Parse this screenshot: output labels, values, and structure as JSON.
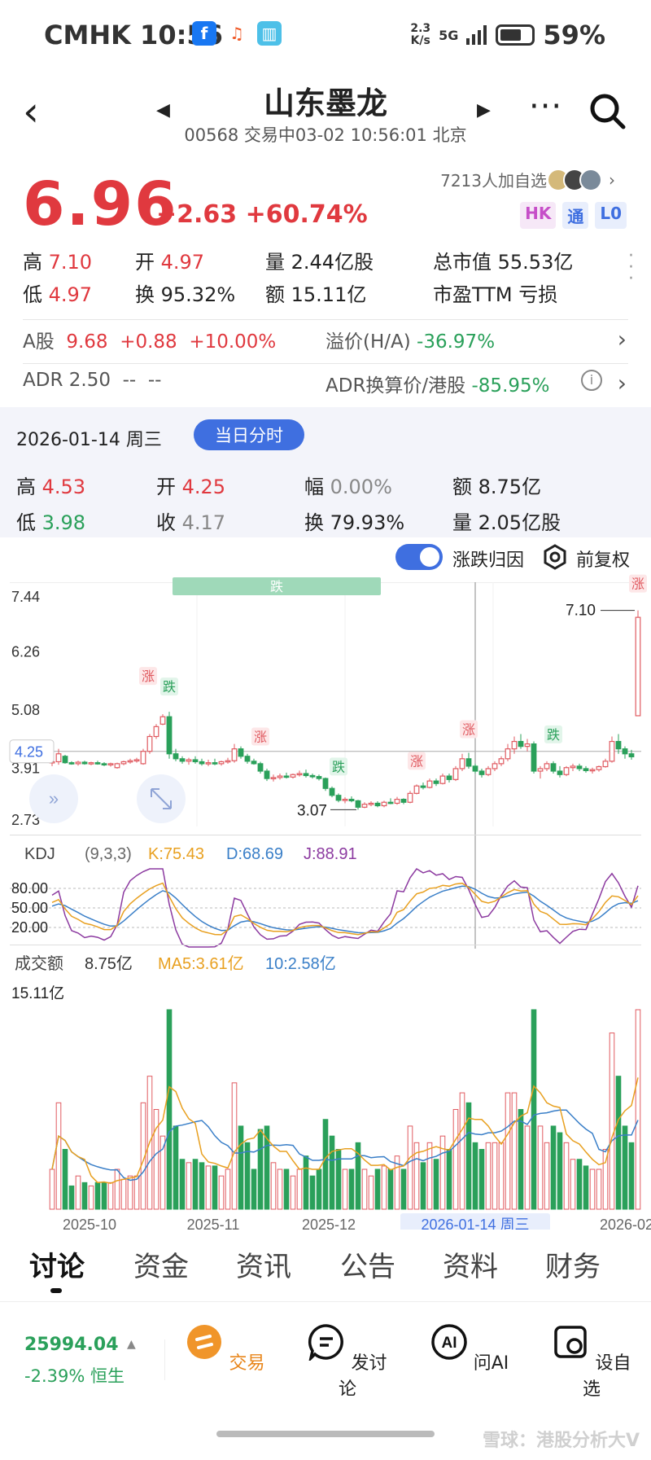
{
  "status_bar": {
    "carrier": "CMHK",
    "time": "10:56",
    "speed_top": "2.3",
    "speed_bottom": "K/s",
    "network": "5G",
    "battery": "59%",
    "battery_level": 0.59
  },
  "header": {
    "title": "山东墨龙",
    "subtitle": "00568 交易中03-02 10:56:01 北京",
    "more_icon": "more-dots-icon",
    "search_icon": "search-icon"
  },
  "quote": {
    "price": "6.96",
    "change": "+2.63",
    "change_pct": "+60.74%",
    "watchers": "7213人加自选",
    "badges": [
      "HK",
      "通",
      "L0"
    ],
    "high_label": "高",
    "high": "7.10",
    "open_label": "开",
    "open": "4.97",
    "volume_label": "量",
    "volume": "2.44亿股",
    "mcap_label": "总市值",
    "mcap": "55.53亿",
    "low_label": "低",
    "low": "4.97",
    "turnover_label": "换",
    "turnover": "95.32%",
    "amount_label": "额",
    "amount": "15.11亿",
    "pe_label": "市盈TTM",
    "pe": "亏损",
    "a_share": {
      "label": "A股",
      "price": "9.68",
      "change": "+0.88",
      "pct": "+10.00%",
      "premium_label": "溢价(H/A)",
      "premium": "-36.97%"
    },
    "adr": {
      "label": "ADR",
      "price": "2.50",
      "v1": "--",
      "v2": "--",
      "conv_label": "ADR换算价/港股",
      "conv": "-85.95%"
    }
  },
  "day_panel": {
    "date": "2026-01-14 周三",
    "button": "当日分时",
    "high_label": "高",
    "high": "4.53",
    "open_label": "开",
    "open": "4.25",
    "amp_label": "幅",
    "amp": "0.00%",
    "amount_label": "额",
    "amount": "8.75亿",
    "low_label": "低",
    "low": "3.98",
    "close_label": "收",
    "close": "4.17",
    "turn_label": "换",
    "turn": "79.93%",
    "vol_label": "量",
    "vol": "2.05亿股"
  },
  "toolbar": {
    "toggle_label": "涨跌归因",
    "adjust_label": "前复权"
  },
  "chart_data": [
    {
      "type": "candlestick",
      "title": "",
      "ylim": [
        2.73,
        7.44
      ],
      "y_ticks": [
        "7.44",
        "6.26",
        "5.08",
        "3.91",
        "2.73"
      ],
      "crosshair_value": "4.25",
      "max_label": "7.10",
      "min_label": "3.07",
      "event_labels": [
        "跌",
        "跌",
        "涨",
        "涨",
        "跌",
        "涨",
        "涨",
        "跌",
        "涨"
      ],
      "candles": [
        [
          4.02,
          4.07,
          3.95,
          4.04
        ],
        [
          4.04,
          4.3,
          3.98,
          4.2
        ],
        [
          4.15,
          4.18,
          4.0,
          4.02
        ],
        [
          4.02,
          4.05,
          3.98,
          4.0
        ],
        [
          4.0,
          4.06,
          3.96,
          4.03
        ],
        [
          4.03,
          4.06,
          3.98,
          4.0
        ],
        [
          4.0,
          4.04,
          3.97,
          4.02
        ],
        [
          4.02,
          4.06,
          3.98,
          4.0
        ],
        [
          4.0,
          4.03,
          3.95,
          3.98
        ],
        [
          3.98,
          4.02,
          3.94,
          4.0
        ],
        [
          3.92,
          4.02,
          3.9,
          4.0
        ],
        [
          4.0,
          4.06,
          3.97,
          4.04
        ],
        [
          4.04,
          4.1,
          4.0,
          4.06
        ],
        [
          4.06,
          4.12,
          4.02,
          4.08
        ],
        [
          4.0,
          4.3,
          3.98,
          4.25
        ],
        [
          4.25,
          4.6,
          4.2,
          4.55
        ],
        [
          4.55,
          4.8,
          4.5,
          4.75
        ],
        [
          4.8,
          5.0,
          4.78,
          4.95
        ],
        [
          4.95,
          5.05,
          4.1,
          4.2
        ],
        [
          4.2,
          4.3,
          4.05,
          4.1
        ],
        [
          4.1,
          4.15,
          4.0,
          4.05
        ],
        [
          4.05,
          4.12,
          3.98,
          4.08
        ],
        [
          4.08,
          4.15,
          4.0,
          4.04
        ],
        [
          4.04,
          4.1,
          3.96,
          4.0
        ],
        [
          4.0,
          4.08,
          3.95,
          4.02
        ],
        [
          4.02,
          4.1,
          3.97,
          4.0
        ],
        [
          4.0,
          4.06,
          3.96,
          4.04
        ],
        [
          4.04,
          4.12,
          4.0,
          4.06
        ],
        [
          4.06,
          4.4,
          4.02,
          4.3
        ],
        [
          4.3,
          4.35,
          4.1,
          4.15
        ],
        [
          4.15,
          4.2,
          4.0,
          4.05
        ],
        [
          4.05,
          4.1,
          3.98,
          4.0
        ],
        [
          4.0,
          4.04,
          3.8,
          3.85
        ],
        [
          3.85,
          3.9,
          3.65,
          3.7
        ],
        [
          3.7,
          3.78,
          3.64,
          3.72
        ],
        [
          3.72,
          3.8,
          3.68,
          3.75
        ],
        [
          3.75,
          3.82,
          3.7,
          3.73
        ],
        [
          3.73,
          3.8,
          3.7,
          3.78
        ],
        [
          3.78,
          3.86,
          3.74,
          3.8
        ],
        [
          3.8,
          3.88,
          3.72,
          3.76
        ],
        [
          3.76,
          3.8,
          3.7,
          3.74
        ],
        [
          3.74,
          3.78,
          3.66,
          3.7
        ],
        [
          3.7,
          3.72,
          3.45,
          3.5
        ],
        [
          3.5,
          3.54,
          3.32,
          3.36
        ],
        [
          3.36,
          3.4,
          3.22,
          3.26
        ],
        [
          3.26,
          3.32,
          3.2,
          3.28
        ],
        [
          3.28,
          3.34,
          3.22,
          3.25
        ],
        [
          3.25,
          3.27,
          3.07,
          3.12
        ],
        [
          3.12,
          3.22,
          3.1,
          3.18
        ],
        [
          3.18,
          3.24,
          3.14,
          3.2
        ],
        [
          3.2,
          3.24,
          3.12,
          3.15
        ],
        [
          3.15,
          3.25,
          3.12,
          3.22
        ],
        [
          3.22,
          3.3,
          3.18,
          3.2
        ],
        [
          3.2,
          3.33,
          3.17,
          3.28
        ],
        [
          3.28,
          3.3,
          3.18,
          3.22
        ],
        [
          3.22,
          3.45,
          3.2,
          3.4
        ],
        [
          3.4,
          3.58,
          3.38,
          3.55
        ],
        [
          3.55,
          3.62,
          3.48,
          3.52
        ],
        [
          3.52,
          3.7,
          3.5,
          3.65
        ],
        [
          3.65,
          3.7,
          3.55,
          3.6
        ],
        [
          3.6,
          3.8,
          3.58,
          3.75
        ],
        [
          3.75,
          3.8,
          3.62,
          3.68
        ],
        [
          3.68,
          3.95,
          3.65,
          3.9
        ],
        [
          3.9,
          4.2,
          3.85,
          4.1
        ],
        [
          4.1,
          4.22,
          3.9,
          3.95
        ],
        [
          3.95,
          4.0,
          3.8,
          3.85
        ],
        [
          3.85,
          3.9,
          3.72,
          3.78
        ],
        [
          3.78,
          3.95,
          3.75,
          3.9
        ],
        [
          3.9,
          4.05,
          3.85,
          4.0
        ],
        [
          4.0,
          4.15,
          3.95,
          4.1
        ],
        [
          4.1,
          4.4,
          4.05,
          4.3
        ],
        [
          4.3,
          4.55,
          4.2,
          4.45
        ],
        [
          4.45,
          4.6,
          4.3,
          4.35
        ],
        [
          4.35,
          4.5,
          4.25,
          4.4
        ],
        [
          4.4,
          4.45,
          3.8,
          3.85
        ],
        [
          3.85,
          3.95,
          3.7,
          3.9
        ],
        [
          3.9,
          4.05,
          3.85,
          4.0
        ],
        [
          4.0,
          4.05,
          3.8,
          3.85
        ],
        [
          3.85,
          3.95,
          3.72,
          3.78
        ],
        [
          3.78,
          3.95,
          3.75,
          3.92
        ],
        [
          3.92,
          4.0,
          3.85,
          3.95
        ],
        [
          3.95,
          4.0,
          3.85,
          3.9
        ],
        [
          3.9,
          3.95,
          3.82,
          3.86
        ],
        [
          3.86,
          3.92,
          3.8,
          3.88
        ],
        [
          3.88,
          3.96,
          3.84,
          3.94
        ],
        [
          3.94,
          4.1,
          3.92,
          4.05
        ],
        [
          4.05,
          4.55,
          4.02,
          4.45
        ],
        [
          4.45,
          4.6,
          4.2,
          4.3
        ],
        [
          4.3,
          4.35,
          4.1,
          4.2
        ],
        [
          4.2,
          4.28,
          4.08,
          4.14
        ],
        [
          4.97,
          7.1,
          4.97,
          6.96
        ]
      ]
    },
    {
      "type": "line",
      "title": "KDJ",
      "params": "(9,3,3)",
      "series_labels": [
        {
          "name": "K",
          "value": "75.43"
        },
        {
          "name": "D",
          "value": "68.69"
        },
        {
          "name": "J",
          "value": "88.91"
        }
      ],
      "colors": {
        "K": "#e8a020",
        "D": "#3a7fc8",
        "J": "#8c3aa0"
      },
      "y_ticks": [
        "80.00",
        "50.00",
        "20.00"
      ],
      "ylim": [
        0,
        100
      ]
    },
    {
      "type": "bar",
      "title": "成交额",
      "latest": "8.75亿",
      "ma_labels": [
        {
          "name": "MA5",
          "value": "3.61亿"
        },
        {
          "name": "10",
          "value": "2.58亿"
        }
      ],
      "y_max_label": "15.11亿",
      "ma_colors": {
        "MA5": "#e8a020",
        "MA10": "#3a7fc8"
      },
      "x_ticks": [
        "2025-10",
        "2025-11",
        "2025-12",
        "2026-01-14 周三",
        "2026-02"
      ]
    }
  ],
  "tabs": [
    "讨论",
    "资金",
    "资讯",
    "公告",
    "资料",
    "财务"
  ],
  "bottom": {
    "index_value": "25994.04",
    "index_change": "-2.39%",
    "index_name": "恒生",
    "actions": [
      {
        "label": "交易",
        "icon": "trade-icon"
      },
      {
        "label": "发讨论",
        "icon": "discuss-icon"
      },
      {
        "label": "问AI",
        "icon": "ai-icon"
      },
      {
        "label": "设自选",
        "icon": "watchlist-icon"
      }
    ],
    "watermark": "雪球：港股分析大V"
  }
}
